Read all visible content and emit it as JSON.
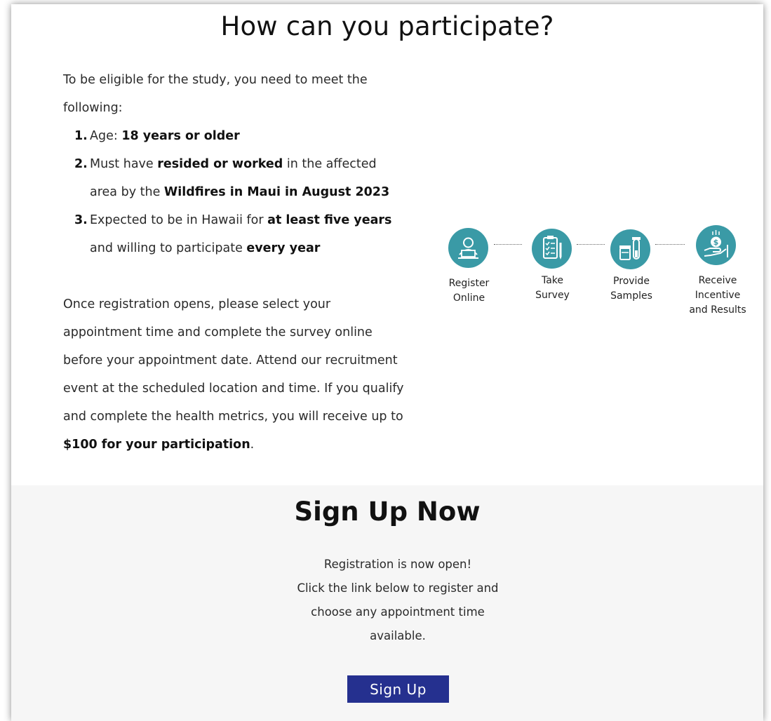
{
  "participate": {
    "title": "How can you participate?",
    "intro": "To be eligible for the study, you need to meet the following:",
    "criteria": [
      {
        "num": "1.",
        "parts": [
          {
            "text": "Age: ",
            "bold": false
          },
          {
            "text": "18 years or older",
            "bold": true
          }
        ]
      },
      {
        "num": "2.",
        "parts": [
          {
            "text": "Must have ",
            "bold": false
          },
          {
            "text": "resided or worked",
            "bold": true
          },
          {
            "text": " in the affected area by the ",
            "bold": false
          },
          {
            "text": "Wildfires in Maui in August 2023",
            "bold": true
          }
        ]
      },
      {
        "num": "3.",
        "parts": [
          {
            "text": "Expected to be in Hawaii for ",
            "bold": false
          },
          {
            "text": "at least five years",
            "bold": true
          },
          {
            "text": " and willing to participate ",
            "bold": false
          },
          {
            "text": "every year",
            "bold": true
          }
        ]
      }
    ],
    "details": [
      {
        "text": "Once registration opens, please select your appointment time and complete the survey online before your appointment date. Attend our recruitment event at the scheduled location and time. If you qualify and complete the health metrics, you will receive up to ",
        "bold": false
      },
      {
        "text": "$100 for your participation",
        "bold": true
      },
      {
        "text": ".",
        "bold": false
      }
    ],
    "steps": [
      {
        "label": "Register\nOnline",
        "icon": "laptop-user-icon"
      },
      {
        "label": "Take\nSurvey",
        "icon": "clipboard-checklist-icon"
      },
      {
        "label": "Provide\nSamples",
        "icon": "sample-containers-icon"
      },
      {
        "label": "Receive\nIncentive\nand Results",
        "icon": "money-hand-icon"
      }
    ]
  },
  "signup": {
    "title": "Sign Up Now",
    "lines": [
      "Registration is now open!",
      "Click the link below to register and",
      "choose any appointment time",
      "available."
    ],
    "button_label": "Sign Up"
  },
  "colors": {
    "icon_teal": "#3a9aa6",
    "button_navy": "#25308f",
    "bottom_bg": "#f6f6f6"
  }
}
